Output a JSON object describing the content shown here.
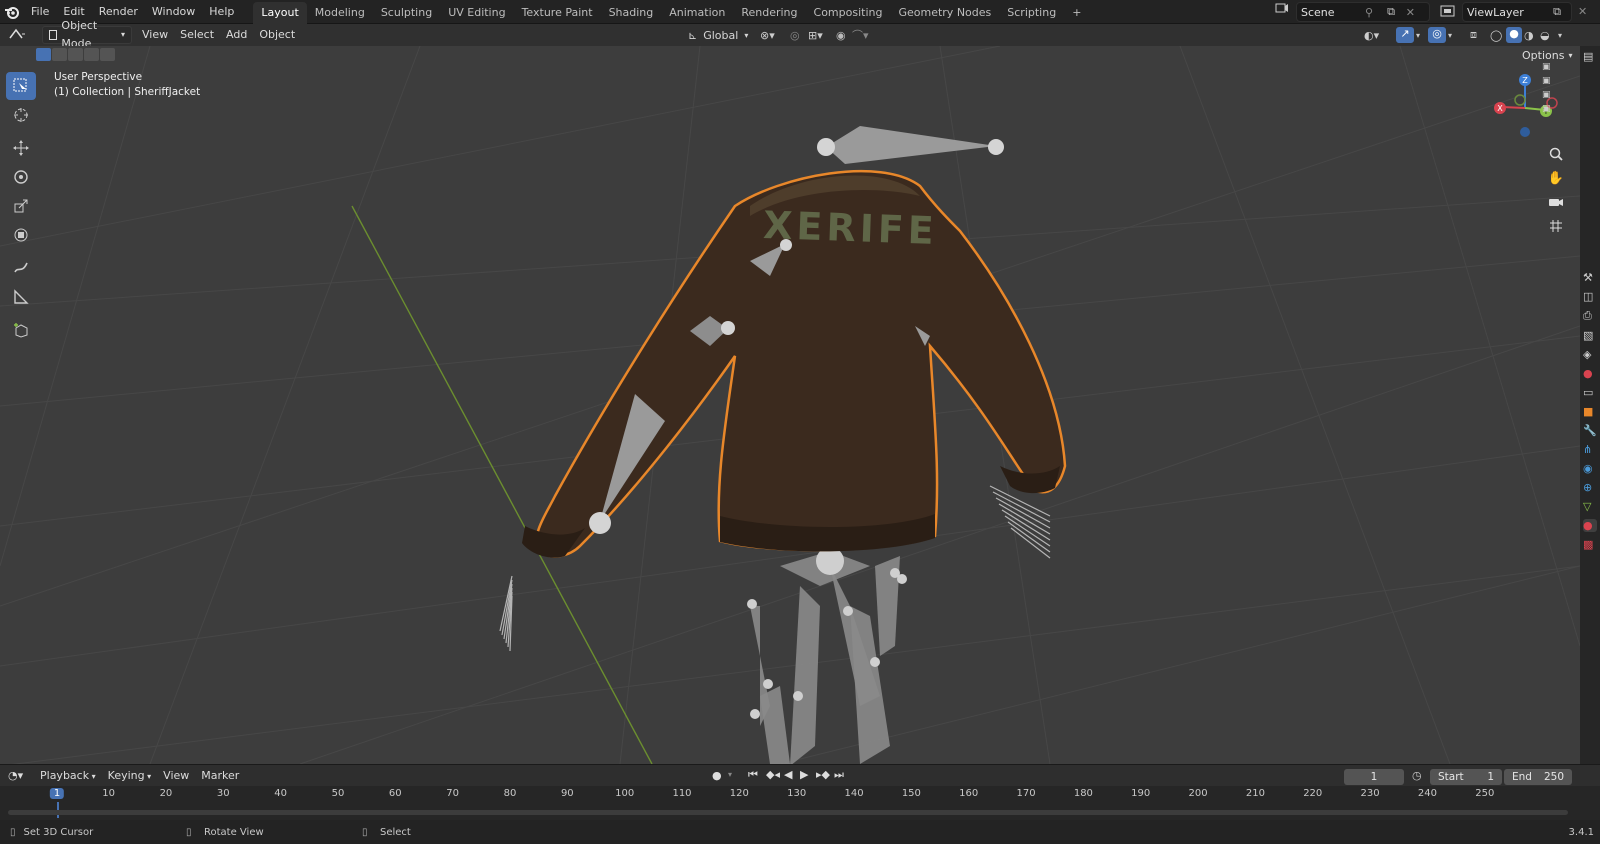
{
  "topbar": {
    "menus": [
      "File",
      "Edit",
      "Render",
      "Window",
      "Help"
    ],
    "workspaces": [
      "Layout",
      "Modeling",
      "Sculpting",
      "UV Editing",
      "Texture Paint",
      "Shading",
      "Animation",
      "Rendering",
      "Compositing",
      "Geometry Nodes",
      "Scripting"
    ],
    "active_workspace": "Layout",
    "add_tab": "+",
    "scene_name": "Scene",
    "view_layer": "ViewLayer"
  },
  "viewport_header": {
    "mode": "Object Mode",
    "menus": [
      "View",
      "Select",
      "Add",
      "Object"
    ],
    "orientation": "Global",
    "options": "Options"
  },
  "viewport": {
    "perspective": "User Perspective",
    "collection": "(1) Collection | SheriffJacket",
    "jacket_text": "XERIFE",
    "gizmo_axes": {
      "x": "X",
      "y": "Y",
      "z": "Z"
    },
    "colors": {
      "bg": "#3d3d3d",
      "selection_outline": "#e8872a",
      "jacket": "#3b2a1e",
      "axis_x": "#d9434f",
      "axis_y": "#8bc34a",
      "axis_z": "#3d7fd6"
    }
  },
  "timeline": {
    "menus": [
      "Playback",
      "Keying",
      "View",
      "Marker"
    ],
    "current_frame": "1",
    "start_label": "Start",
    "start_value": "1",
    "end_label": "End",
    "end_value": "250",
    "ticks": [
      "1",
      "10",
      "20",
      "30",
      "40",
      "50",
      "60",
      "70",
      "80",
      "90",
      "100",
      "110",
      "120",
      "130",
      "140",
      "150",
      "160",
      "170",
      "180",
      "190",
      "200",
      "210",
      "220",
      "230",
      "240",
      "250"
    ]
  },
  "status": {
    "left": "Set 3D Cursor",
    "middle": "Rotate View",
    "right": "Select",
    "version": "3.4.1"
  }
}
